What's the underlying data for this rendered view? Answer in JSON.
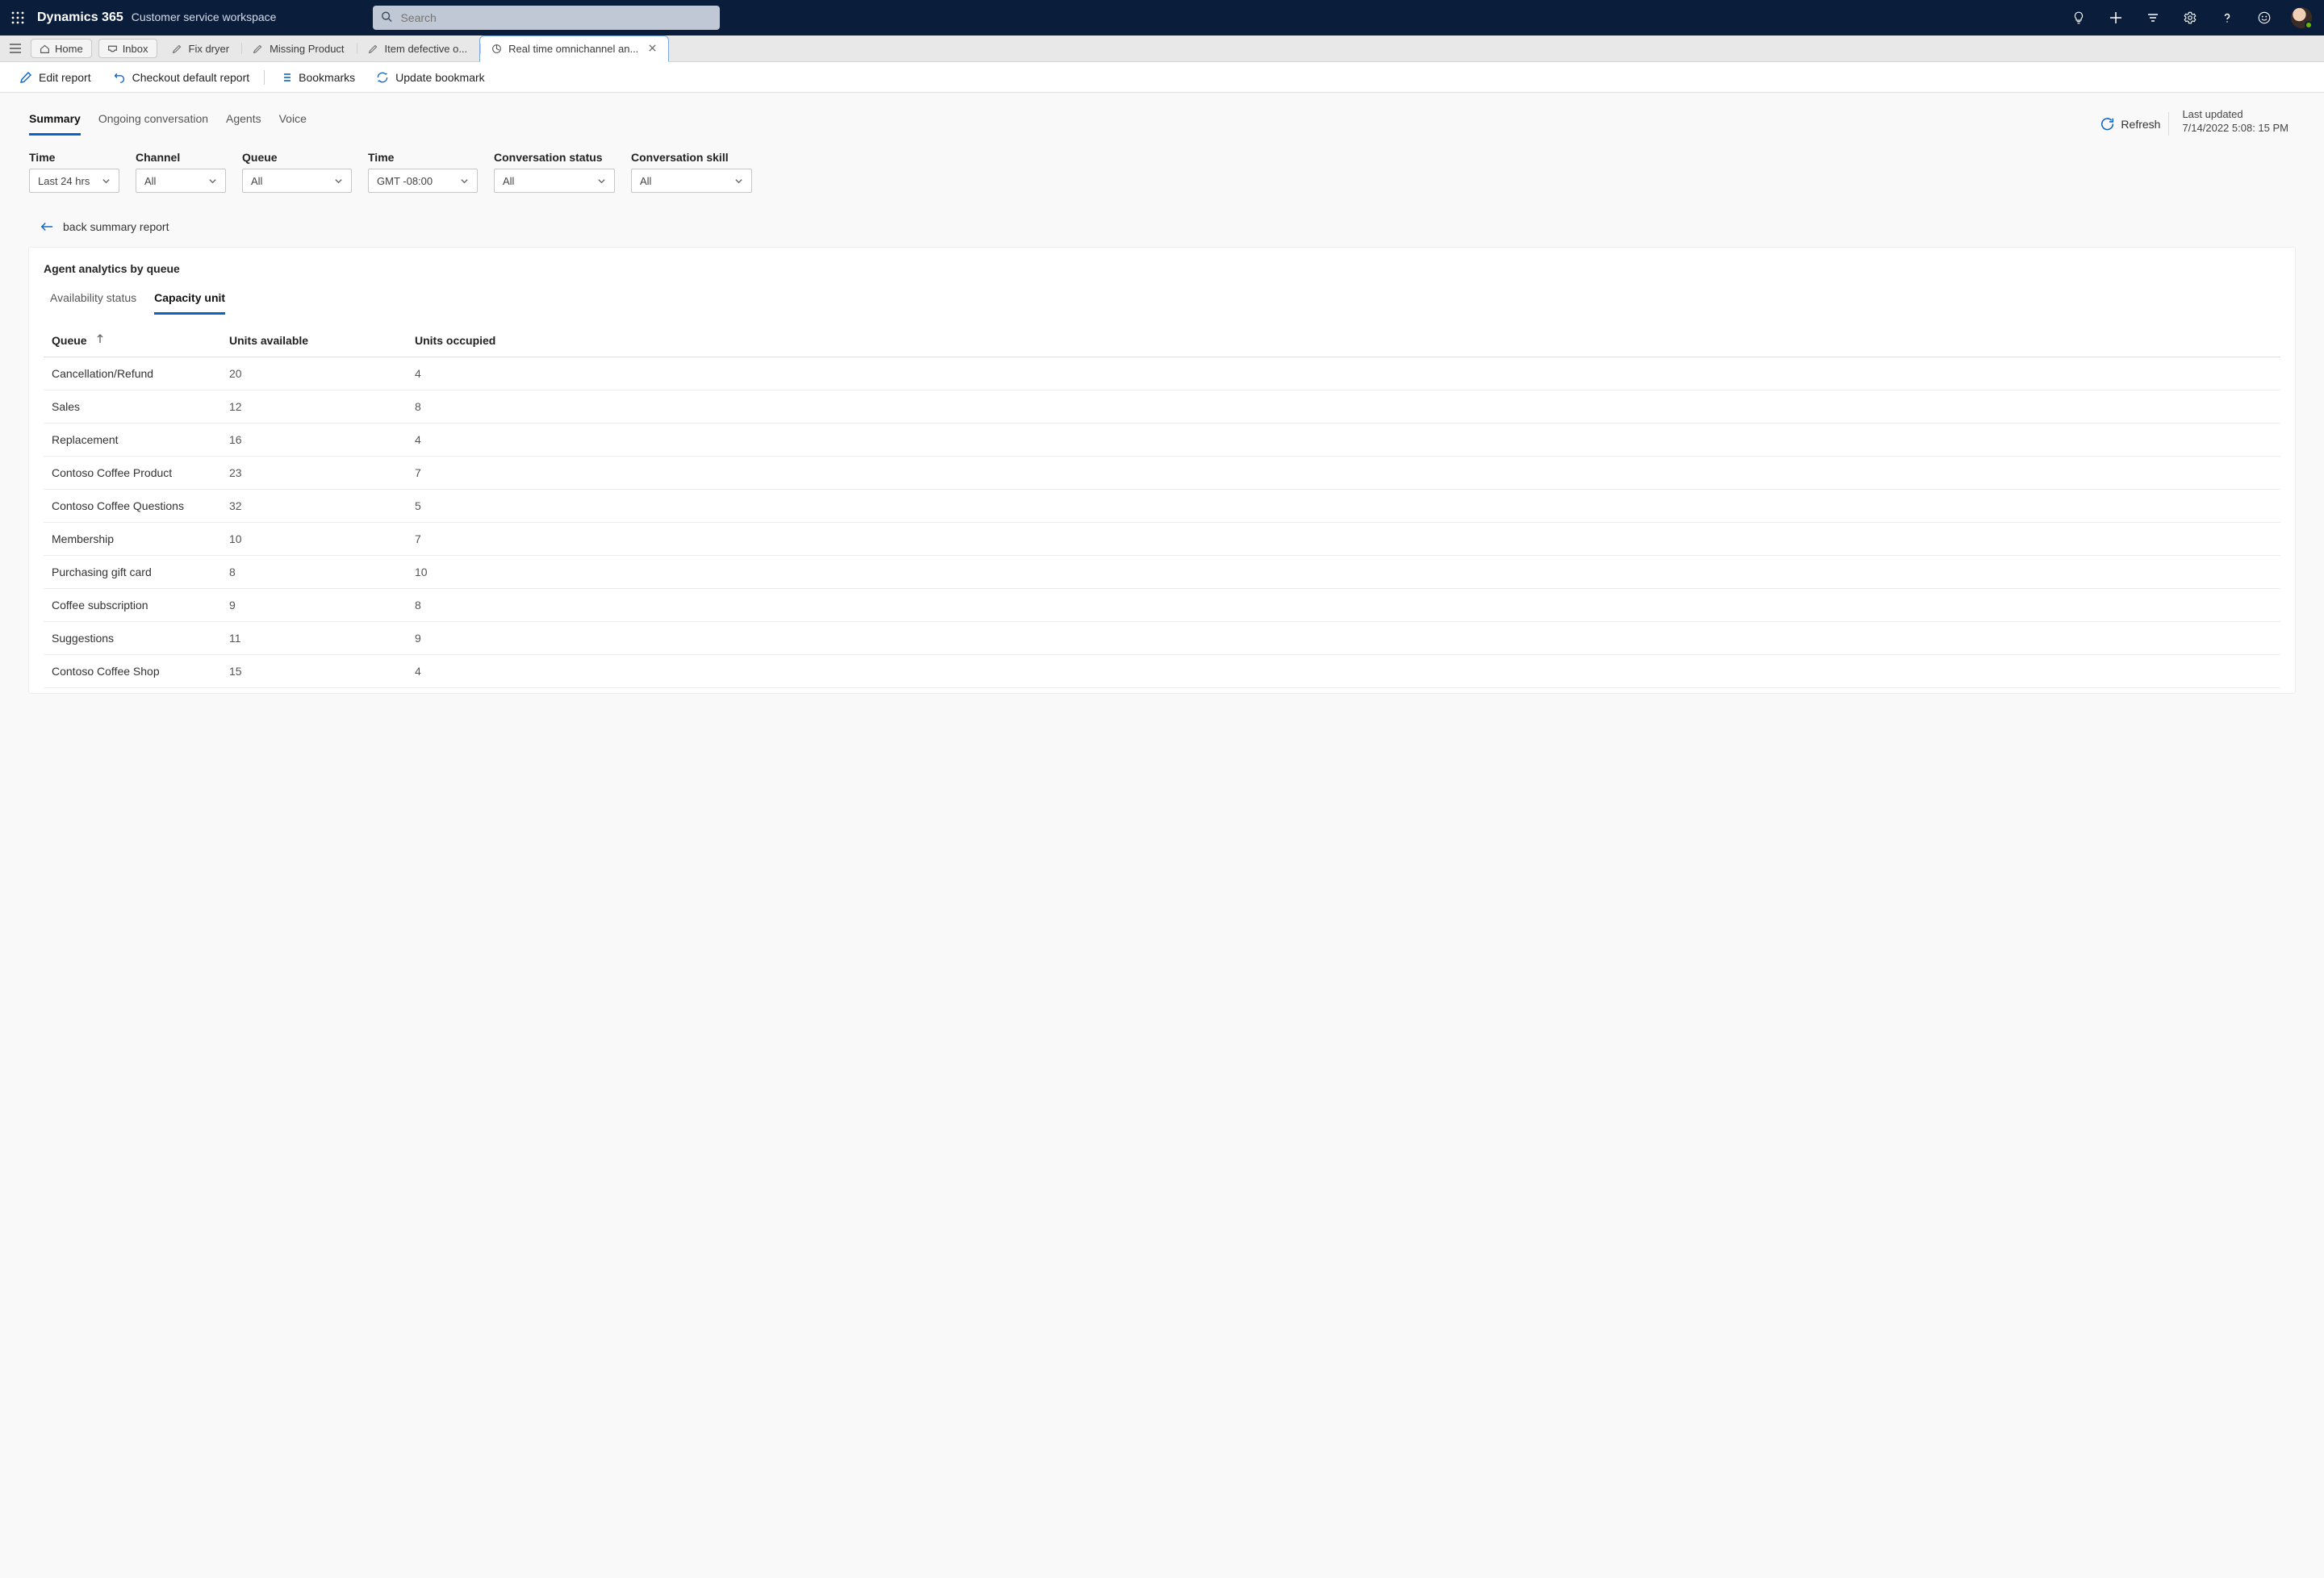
{
  "header": {
    "brand": "Dynamics 365",
    "workspace": "Customer service workspace",
    "search_placeholder": "Search"
  },
  "systabs": {
    "home": "Home",
    "inbox": "Inbox"
  },
  "doctabs": [
    {
      "label": "Fix dryer"
    },
    {
      "label": "Missing Product"
    },
    {
      "label": "Item defective o..."
    },
    {
      "label": "Real time omnichannel an...",
      "active": true
    }
  ],
  "cmdbar": {
    "edit": "Edit report",
    "checkout": "Checkout default report",
    "bookmarks": "Bookmarks",
    "update": "Update bookmark"
  },
  "report_tabs": {
    "summary": "Summary",
    "ongoing": "Ongoing conversation",
    "agents": "Agents",
    "voice": "Voice"
  },
  "refresh_label": "Refresh",
  "last_updated": {
    "label": "Last updated",
    "value": "7/14/2022 5:08: 15 PM"
  },
  "filters": {
    "time": {
      "label": "Time",
      "value": "Last 24 hrs"
    },
    "channel": {
      "label": "Channel",
      "value": "All"
    },
    "queue": {
      "label": "Queue",
      "value": "All"
    },
    "tz": {
      "label": "Time",
      "value": "GMT -08:00"
    },
    "status": {
      "label": "Conversation status",
      "value": "All"
    },
    "skill": {
      "label": "Conversation skill",
      "value": "All"
    }
  },
  "back_label": "back summary report",
  "card_title": "Agent analytics by queue",
  "subtabs": {
    "availability": "Availability status",
    "capacity": "Capacity unit"
  },
  "columns": {
    "queue": "Queue",
    "available": "Units available",
    "occupied": "Units occupied"
  },
  "rows": [
    {
      "queue": "Cancellation/Refund",
      "available": "20",
      "occupied": "4"
    },
    {
      "queue": "Sales",
      "available": "12",
      "occupied": "8"
    },
    {
      "queue": "Replacement",
      "available": "16",
      "occupied": "4"
    },
    {
      "queue": "Contoso Coffee Product",
      "available": "23",
      "occupied": "7"
    },
    {
      "queue": "Contoso Coffee Questions",
      "available": "32",
      "occupied": "5"
    },
    {
      "queue": "Membership",
      "available": "10",
      "occupied": "7"
    },
    {
      "queue": "Purchasing gift card",
      "available": "8",
      "occupied": "10"
    },
    {
      "queue": "Coffee subscription",
      "available": "9",
      "occupied": "8"
    },
    {
      "queue": "Suggestions",
      "available": "11",
      "occupied": "9"
    },
    {
      "queue": "Contoso Coffee Shop",
      "available": "15",
      "occupied": "4"
    }
  ],
  "colors": {
    "accent": "#0b63c5",
    "navy": "#0a1d3b"
  }
}
